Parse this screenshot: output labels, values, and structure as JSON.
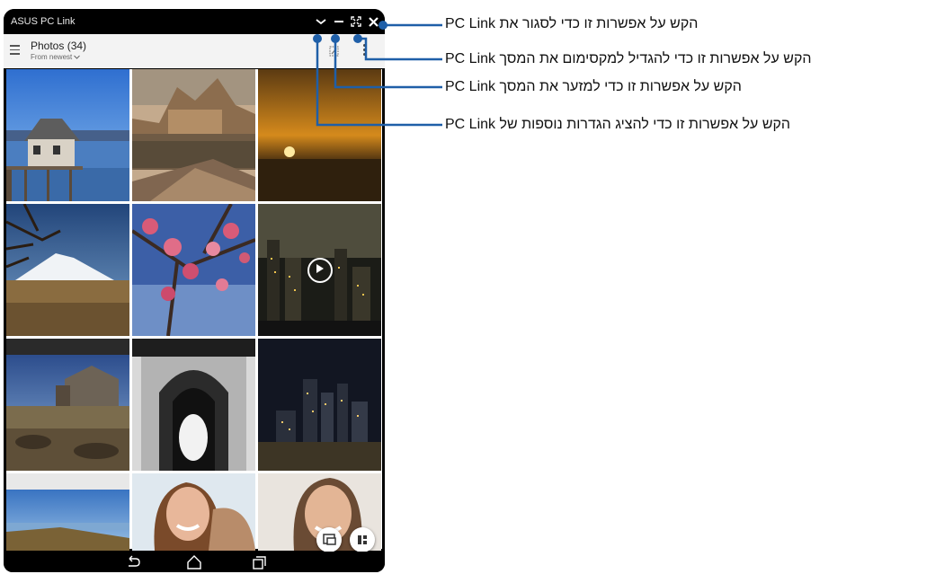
{
  "window": {
    "title": "ASUS PC Link"
  },
  "appbar": {
    "album_title": "Photos (34)",
    "sort_label": "From newest",
    "menu_icon": "hamburger-menu-icon",
    "select_icon": "select-icon",
    "more_icon": "more-vert-icon"
  },
  "titlebar_icons": [
    "chevron-down-icon",
    "minimize-icon",
    "maximize-icon",
    "close-icon"
  ],
  "photos": [
    "pier-house-lake",
    "theme-park-castle",
    "sunset-field",
    "mountain-tree",
    "blossom-branch",
    "city-night-video",
    "stone-church",
    "arched-doorway",
    "city-skyline-night",
    "coastal-landscape",
    "smiling-woman",
    "smiling-man"
  ],
  "fabs": [
    "slideshow-icon",
    "layout-icon"
  ],
  "navbar": [
    "back-icon",
    "home-icon",
    "recent-apps-icon"
  ],
  "callouts": {
    "close": "הקש על אפשרות זו כדי לסגור את PC Link",
    "maximize": "הקש על אפשרות זו כדי להגדיל למקסימום את המסך PC Link",
    "minimize": "הקש על אפשרות זו כדי למזער את המסך PC Link",
    "more": "הקש על אפשרות זו כדי להציג הגדרות נוספות של PC Link"
  },
  "colors": {
    "callout_line": "#1f5fa8",
    "titlebar": "#000000",
    "appbar": "#f3f3f3"
  }
}
